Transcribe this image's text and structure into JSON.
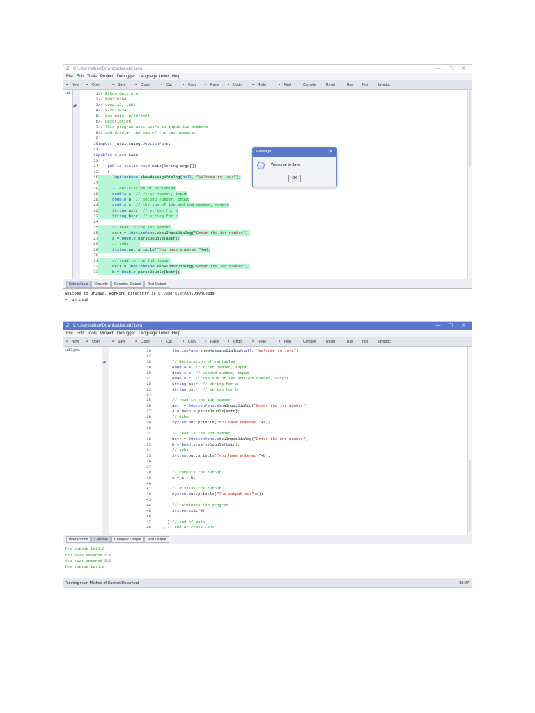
{
  "colors": {
    "highlight": "#b7f7d8",
    "comment": "#1a9a1a",
    "string": "#c42020",
    "keyword": "#2b3cb0",
    "active_title": "#5a78c8"
  },
  "window_title": "C:\\Users\\ethan\\Downloads\\Lab2.java",
  "window_controls": [
    "—",
    "▢",
    "✕"
  ],
  "app_icon": "J",
  "menu": [
    "File",
    "Edit",
    "Tools",
    "Project",
    "Debugger",
    "Language Level",
    "Help"
  ],
  "toolbar": [
    {
      "label": "New",
      "icon": "new-file-icon"
    },
    {
      "label": "Open",
      "icon": "open-folder-icon"
    },
    {
      "label": "Save",
      "icon": "save-icon"
    },
    {
      "label": "Close",
      "icon": "close-file-icon"
    },
    {
      "label": "Cut",
      "icon": "scissors-icon"
    },
    {
      "label": "Copy",
      "icon": "copy-icon"
    },
    {
      "label": "Paste",
      "icon": "paste-icon"
    },
    {
      "label": "Undo",
      "icon": "undo-icon"
    },
    {
      "label": "Redo",
      "icon": "redo-icon"
    },
    {
      "label": "Find",
      "icon": "binoculars-icon"
    },
    {
      "label": "Compile",
      "icon": ""
    },
    {
      "label": "Reset",
      "icon": ""
    },
    {
      "label": "Run",
      "icon": ""
    },
    {
      "label": "Test",
      "icon": ""
    },
    {
      "label": "Javadoc",
      "icon": ""
    }
  ],
  "code": [
    "// Ethan Guillote",
    "// N00370294",
    "// comp135, Lab2",
    "// 8/26/2024",
    "// Due Date: 8/28/2024",
    "// Description:",
    "// This program asks users to input two numbers",
    "// and display the sum of the two numbers.",
    "",
    "import javax.swing.JOptionPane;",
    "",
    "public class Lab2",
    "  {",
    "    public static void main(String args[])",
    "    {",
    "      JOptionPane.showMessageDialog(null, \"Welcome to Java\");",
    "",
    "      // declaration of variables",
    "      double a; // first number, input",
    "      double b; // second number, input",
    "      double c; // the sum of 1st and 2nd number, output",
    "      String astr; // string for a",
    "      String bstr; // string for b",
    "",
    "      // read in the 1st number",
    "      astr = JOptionPane.showInputDialog(\"Enter the 1st number\");",
    "      a = Double.parseDouble(astr);",
    "      // echo",
    "      System.out.println(\"You have entered \"+a);",
    "",
    "      // read in the 2nd number",
    "      bstr = JOptionPane.showInputDialog(\"Enter the 2nd number\");",
    "      b = Double.parseDouble(bstr);",
    "      // echo",
    "      System.out.println(\"You have entered \"+b);",
    "",
    "",
    "      // compute the output",
    "      c = a + b;",
    "",
    "      // display the output",
    "      System.out.println(\"The output is:\"+c);",
    "",
    "      // terminate the program",
    "      System.exit(0);",
    "",
    "    } // end of main",
    "  } // end of class Lab2"
  ],
  "tabs": [
    "Interactions",
    "Console",
    "Compiler Output",
    "Test Output"
  ],
  "window1": {
    "file_list": [
      "Lab"
    ],
    "first_line": 1,
    "last_line": 33,
    "highlighted_lines": [
      16,
      17,
      18,
      19,
      20,
      21,
      22,
      23,
      25,
      26,
      27,
      28,
      29,
      31,
      32,
      33
    ],
    "selected_tab": "Interactions",
    "interactions": [
      "Welcome to DrJava.  Working directory is C:\\Users\\ethan\\Downloads",
      "> run Lab2"
    ],
    "dialog": {
      "title": "Message",
      "message": "Welcome to Java",
      "ok": "OK",
      "icon": "i",
      "close": "✕"
    }
  },
  "window2": {
    "file_list": [
      "Lab2.java"
    ],
    "first_line": 16,
    "last_line": 48,
    "selected_tab": "Console",
    "console": [
      "The output is:3.0",
      "You have entered 1.0",
      "You have entered 2.0",
      "The output is:3.0"
    ],
    "status": "Running main Method of Current Document",
    "cursor": "38:27"
  }
}
